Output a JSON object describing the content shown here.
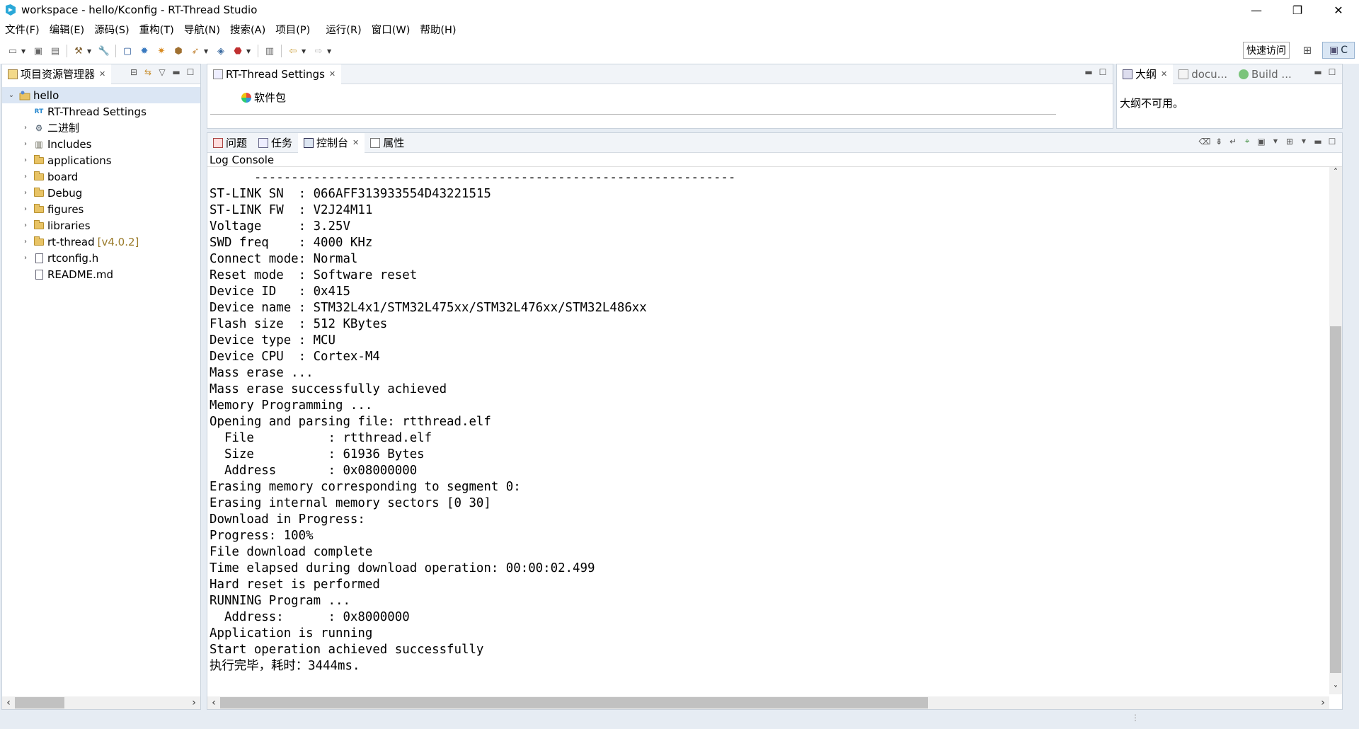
{
  "window": {
    "title": "workspace - hello/Kconfig - RT-Thread Studio",
    "minimize": "—",
    "restore": "❐",
    "close": "✕"
  },
  "menu": [
    "文件(F)",
    "编辑(E)",
    "源码(S)",
    "重构(T)",
    "导航(N)",
    "搜索(A)",
    "项目(P)",
    "运行(R)",
    "窗口(W)",
    "帮助(H)"
  ],
  "toolbar": {
    "quick_access": "快速访问",
    "perspective_label": "C"
  },
  "explorer": {
    "tab_label": "项目资源管理器",
    "root": "hello",
    "items": [
      {
        "label": "RT-Thread Settings",
        "suffix": "",
        "icon": "rt-settings-icon",
        "expandable": false
      },
      {
        "label": "二进制",
        "suffix": "",
        "icon": "binaries-icon",
        "expandable": true
      },
      {
        "label": "Includes",
        "suffix": "",
        "icon": "includes-icon",
        "expandable": true
      },
      {
        "label": "applications",
        "suffix": "",
        "icon": "folder-icon",
        "expandable": true
      },
      {
        "label": "board",
        "suffix": "",
        "icon": "folder-icon",
        "expandable": true
      },
      {
        "label": "Debug",
        "suffix": "",
        "icon": "folder-icon",
        "expandable": true
      },
      {
        "label": "figures",
        "suffix": "",
        "icon": "folder-icon",
        "expandable": true
      },
      {
        "label": "libraries",
        "suffix": "",
        "icon": "folder-icon",
        "expandable": true
      },
      {
        "label": "rt-thread",
        "suffix": "[v4.0.2]",
        "icon": "folder-icon",
        "expandable": true
      },
      {
        "label": "rtconfig.h",
        "suffix": "",
        "icon": "header-file-icon",
        "expandable": true
      },
      {
        "label": "README.md",
        "suffix": "",
        "icon": "file-icon",
        "expandable": false
      }
    ]
  },
  "editor": {
    "tab_label": "RT-Thread Settings",
    "section_label": "软件包"
  },
  "outline": {
    "tabs": [
      "大纲",
      "docu...",
      "Build ..."
    ],
    "message": "大纲不可用。"
  },
  "bottom_tabs": [
    "问题",
    "任务",
    "控制台",
    "属性"
  ],
  "console": {
    "header": "Log Console",
    "lines": [
      "      -----------------------------------------------------------------",
      "ST-LINK SN  : 066AFF313933554D43221515",
      "ST-LINK FW  : V2J24M11",
      "Voltage     : 3.25V",
      "SWD freq    : 4000 KHz",
      "Connect mode: Normal",
      "Reset mode  : Software reset",
      "Device ID   : 0x415",
      "Device name : STM32L4x1/STM32L475xx/STM32L476xx/STM32L486xx",
      "Flash size  : 512 KBytes",
      "Device type : MCU",
      "Device CPU  : Cortex-M4",
      "Mass erase ...",
      "Mass erase successfully achieved",
      "Memory Programming ...",
      "Opening and parsing file: rtthread.elf",
      "  File          : rtthread.elf",
      "  Size          : 61936 Bytes",
      "  Address       : 0x08000000",
      "Erasing memory corresponding to segment 0:",
      "Erasing internal memory sectors [0 30]",
      "Download in Progress:",
      "Progress: 100%",
      "File download complete",
      "Time elapsed during download operation: 00:00:02.499",
      "Hard reset is performed",
      "RUNNING Program ...",
      "  Address:      : 0x8000000",
      "Application is running",
      "Start operation achieved successfully",
      "执行完毕，耗时：3444ms."
    ]
  }
}
